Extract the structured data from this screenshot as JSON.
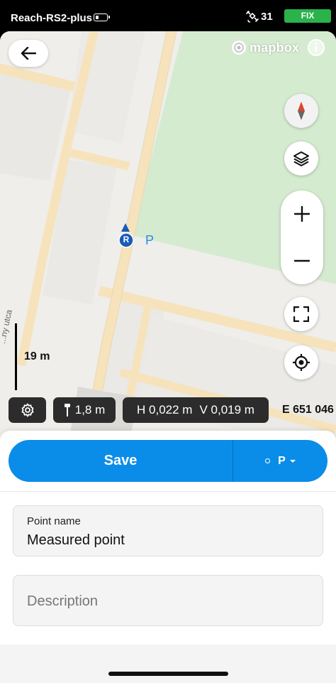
{
  "status_bar": {
    "device_name": "Reach-RS2-plus",
    "satellite_count": "31",
    "fix_status": "FIX",
    "fix_color": "#2ab24b",
    "icons": [
      "battery-icon",
      "satellite-icon"
    ]
  },
  "map": {
    "attribution": "mapbox",
    "scale_label": "19 m",
    "street_label": "...ny utca",
    "rover_marker_letter": "R",
    "point_marker_label": "P",
    "colors": {
      "park": "#d4ebcf",
      "road": "#f6e3bc",
      "land": "#efeeea",
      "marker": "#1a5bb8"
    },
    "controls": [
      "back-icon",
      "compass-icon",
      "layers-icon",
      "zoom-in-icon",
      "zoom-out-icon",
      "fullscreen-icon",
      "locate-icon"
    ]
  },
  "info_bar": {
    "antenna_height": "1,8 m",
    "h_accuracy": "H 0,022 m",
    "v_accuracy": "V 0,019 m",
    "easting": "E 651 046"
  },
  "sheet": {
    "save_label": "Save",
    "code_label": "P",
    "point_name_label": "Point name",
    "point_name_value": "Measured point",
    "description_placeholder": "Description",
    "accent_color": "#0a8de8"
  }
}
